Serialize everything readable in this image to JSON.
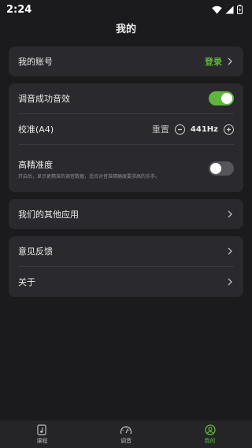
{
  "status_bar": {
    "time": "2:24"
  },
  "header": {
    "title": "我的"
  },
  "account": {
    "label": "我的账号",
    "action": "登录"
  },
  "tuning": {
    "sound_label": "调音成功音效",
    "sound_on": true,
    "calibration_label": "校准(A4)",
    "reset_label": "重置",
    "frequency": "441Hz",
    "precision_label": "高精准度",
    "precision_desc": "开启后，显示更精准的调音数据，适合对音准精确度要求高的乐手。",
    "precision_on": false
  },
  "other_apps": {
    "label": "我们的其他应用"
  },
  "misc": {
    "feedback_label": "意见反馈",
    "about_label": "关于"
  },
  "bottom_nav": {
    "items": [
      {
        "label": "课程",
        "icon": "music-note-icon"
      },
      {
        "label": "调音",
        "icon": "gauge-icon"
      },
      {
        "label": "我的",
        "icon": "profile-icon"
      }
    ],
    "active": 2
  },
  "colors": {
    "accent": "#5fb63d",
    "background": "#1b1b1d",
    "card": "#2a2a2e"
  }
}
